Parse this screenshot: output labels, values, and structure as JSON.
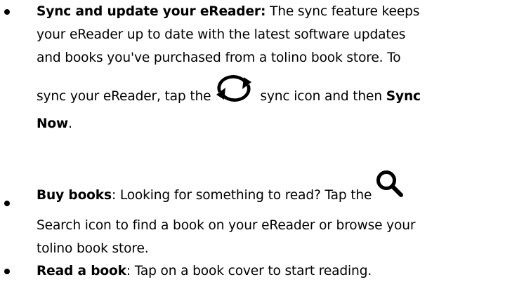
{
  "items": [
    {
      "title": "Sync and update your eReader:",
      "lines": [
        "The sync feature keeps",
        "your eReader up to date with the latest software updates",
        "and books you've purchased from a tolino book store. To",
        "sync your eReader, tap the",
        "sync icon and then",
        "Sync",
        "Now",
        "."
      ],
      "icon": "sync-icon"
    },
    {
      "title": "Buy books",
      "lines": [
        ": Looking for something to read? Tap the",
        "Search icon to find a book on your eReader or browse your",
        "tolino book store."
      ],
      "icon": "search-icon"
    },
    {
      "title": "Read a book",
      "lines": [
        ": Tap on a book cover to start reading."
      ]
    }
  ]
}
